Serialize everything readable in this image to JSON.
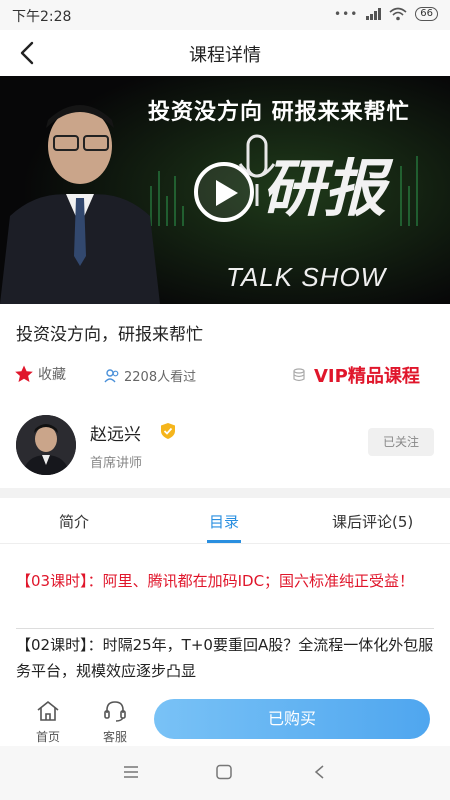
{
  "status_bar": {
    "time": "下午2:28",
    "battery": "66"
  },
  "nav": {
    "title": "课程详情"
  },
  "hero": {
    "headline": "投资没方向 研报来来帮忙",
    "big_text": "研报",
    "talk_show": "TALK SHOW"
  },
  "course": {
    "title": "投资没方向，研报来帮忙"
  },
  "meta": {
    "favorite_label": "收藏",
    "views_label": "2208人看过",
    "vip_label": "VIP精品课程"
  },
  "teacher": {
    "name": "赵远兴",
    "role": "首席讲师",
    "follow_label": "已关注"
  },
  "tabs": [
    {
      "label": "简介"
    },
    {
      "label": "目录"
    },
    {
      "label": "课后评论(5)"
    }
  ],
  "active_tab": "目录",
  "lessons": [
    {
      "text": "【03课时】：阿里、腾讯都在加码IDC；国六标准纯正受益！"
    },
    {
      "text": "【02课时】：时隔25年，T+0要重回A股？全流程一体化外包服务平台，规模效应逐步凸显"
    }
  ],
  "bottom_bar": {
    "home_label": "首页",
    "service_label": "客服",
    "buy_label": "已购买"
  },
  "colors": {
    "accent": "#2a8fe0",
    "vip_red": "#e0162b",
    "buy_button": "#5aaef0"
  },
  "icons": [
    "back-arrow-icon",
    "play-icon",
    "star-icon",
    "users-icon",
    "coin-stack-icon",
    "verified-badge-icon",
    "home-icon",
    "headset-icon",
    "menu-icon",
    "square-icon",
    "back-triangle-icon"
  ]
}
